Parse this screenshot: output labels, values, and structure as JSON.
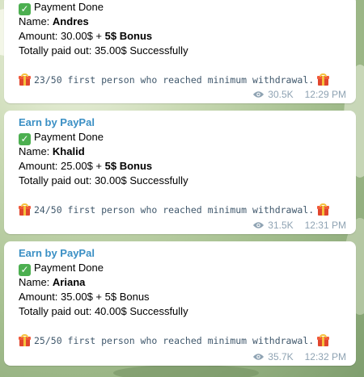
{
  "messages": [
    {
      "sender": "",
      "status": "Payment Done",
      "name_label": "Name:",
      "name": "Andres",
      "amount_label": "Amount:",
      "amount": "30.00$ +",
      "bonus": "5$ Bonus",
      "paid": "Totally paid out: 35.00$ Successfully",
      "note": "23/50 first person who reached minimum withdrawal.",
      "views": "30.5K",
      "time": "12:29 PM"
    },
    {
      "sender": "Earn by PayPal",
      "status": "Payment Done",
      "name_label": "Name:",
      "name": "Khalid",
      "amount_label": "Amount:",
      "amount": "25.00$ +",
      "bonus": "5$ Bonus",
      "paid": "Totally paid out: 30.00$ Successfully",
      "note": "24/50 first person who reached minimum withdrawal.",
      "views": "31.5K",
      "time": "12:31 PM"
    },
    {
      "sender": "Earn by PayPal",
      "status": "Payment Done",
      "name_label": "Name:",
      "name": "Ariana",
      "amount_label": "Amount:",
      "amount": "35.00$ + 5$ Bonus",
      "bonus": "",
      "paid": "Totally paid out: 40.00$ Successfully",
      "note": "25/50 first person who reached minimum withdrawal.",
      "views": "35.7K",
      "time": "12:32 PM"
    }
  ],
  "icons": {
    "status": "check-mark-icon",
    "note": "gift-icon",
    "views": "eye-icon"
  },
  "colors": {
    "sender": "#3a8fc4",
    "meta": "#8fa3b3",
    "check": "#4caf50"
  }
}
